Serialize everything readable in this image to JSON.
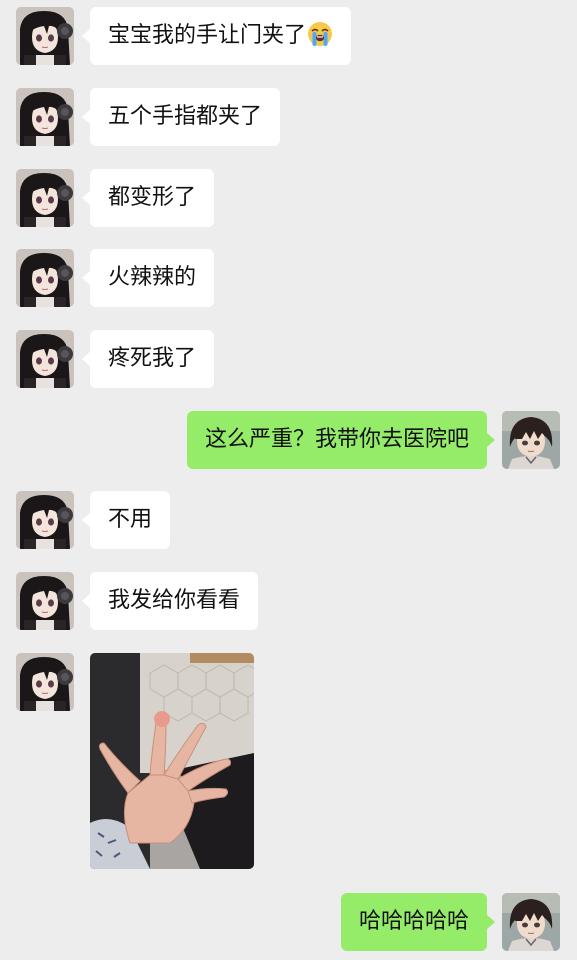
{
  "conversation": {
    "messages": [
      {
        "side": "left",
        "text": "宝宝我的手让门夹了",
        "emoji": "crying-face-icon"
      },
      {
        "side": "left",
        "text": "五个手指都夹了"
      },
      {
        "side": "left",
        "text": "都变形了"
      },
      {
        "side": "left",
        "text": "火辣辣的"
      },
      {
        "side": "left",
        "text": "疼死我了"
      },
      {
        "side": "right",
        "text": "这么严重？我带你去医院吧"
      },
      {
        "side": "left",
        "text": "不用"
      },
      {
        "side": "left",
        "text": "我发给你看看"
      },
      {
        "side": "left",
        "type": "image",
        "image": "hand-photo"
      },
      {
        "side": "right",
        "text": "哈哈哈哈哈"
      }
    ]
  },
  "colors": {
    "background": "#ededed",
    "bubble_left": "#ffffff",
    "bubble_right": "#95ec69"
  }
}
